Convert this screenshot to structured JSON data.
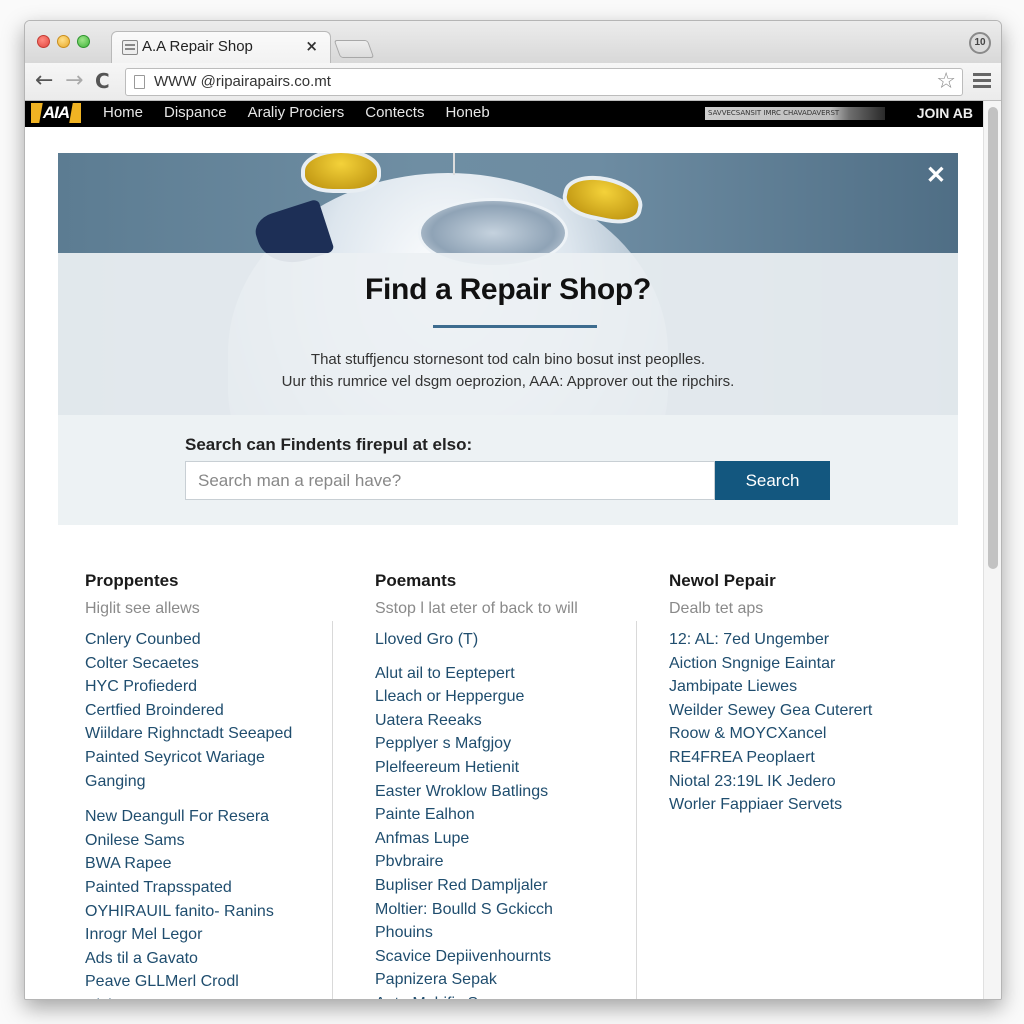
{
  "browser": {
    "tab_title": "A.A Repair Shop",
    "tab_close": "×",
    "profile_badge": "10",
    "url": "WWW @ripairapairs.co.mt",
    "star": "☆",
    "back": "←",
    "forward": "→",
    "reload": "C"
  },
  "site_nav": {
    "logo": "AIA",
    "links": [
      "Home",
      "Dispance",
      "Araliy Prociers",
      "Contects",
      "Honeb"
    ],
    "banner_text": "SAVVECSANSIT IMRC CHAVADAVERST",
    "right_label": "JOIN AB"
  },
  "modal": {
    "close": "✕",
    "title": "Find a Repair Shop?",
    "desc_line1": "That stuffjencu stornesont tod caln bino bosut inst peoplles.",
    "desc_line2": "Uur this rumrice vel dsgm oeprozion, AAA: Approver out the ripchirs.",
    "search_label": "Search can Findents firepul at elso:",
    "search_placeholder": "Search man a repail have?",
    "search_value": "",
    "search_button": "Search"
  },
  "columns": [
    {
      "heading": "Proppentes",
      "subheading": "Higlit see allews",
      "groups": [
        [
          "Cnlery Counbed",
          "Colter Secaetes",
          "HYC Profiederd",
          "Certfied Broindered",
          "Wiildare Righnctadt Seeaped",
          "Painted Seyricot Wariage",
          "Ganging"
        ],
        [
          "New Deangull For Resera",
          "Onilese Sams",
          "BWA Rapee",
          "Painted Trapsspated",
          "OYHIRAUIL fanito- Ranins",
          "Inrogr Mel Legor",
          "Ads til a Gavato",
          "Peave GLLMerl Crodl",
          "Hishen cean"
        ]
      ]
    },
    {
      "heading": "Poemants",
      "subheading": "Sstop l lat eter of back to will",
      "groups": [
        [
          "Lloved Gro (T)"
        ],
        [
          "Alut ail to Eeptepert",
          "Lleach or Heppergue",
          "Uatera Reeaks",
          "Pepplyer s Mafgjoy",
          "Plelfeereum Hetienit",
          "Easter Wroklow Batlings",
          "Painte Ealhon",
          "Anfmas Lupe",
          "Pbvbraire",
          "Bupliser Red Dampljaler",
          "Moltier: Boulld S Gckicch",
          "Phouins",
          "Scavice Depiivenhournts",
          "Papnizera Sepak",
          "Anto Mabific Seuunce"
        ]
      ]
    },
    {
      "heading": "Newol Pepair",
      "subheading": "Dealb tet aps",
      "groups": [
        [
          "12: AL: 7ed Ungember",
          "Aiction Sngnige Eaintar",
          "Jambipate Liewes",
          "Weilder Sewey Gea Cuterert",
          "Roow & MOYCXancel",
          "RE4FREA Peoplaert",
          "Niotal 23:19L IK Jedero",
          "Worler Fappiaer Servets"
        ]
      ]
    }
  ]
}
